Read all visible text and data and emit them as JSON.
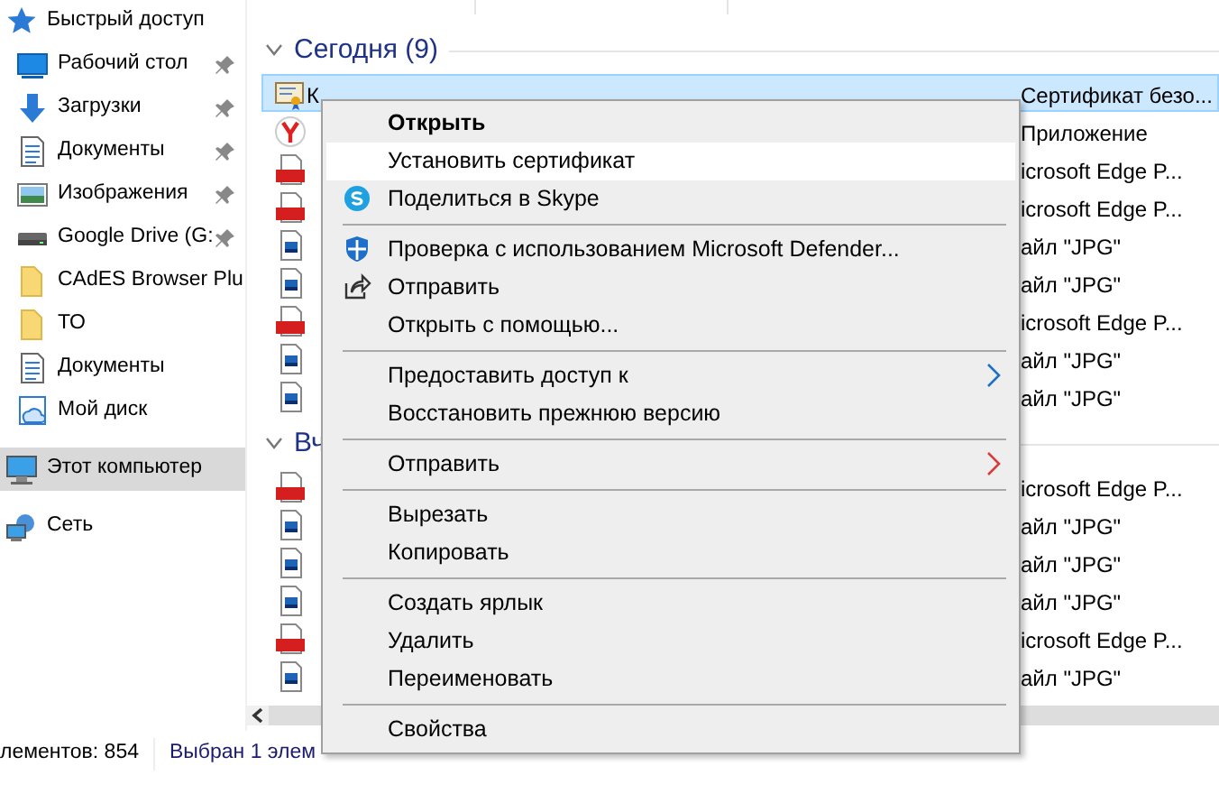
{
  "sidebar": {
    "items": [
      {
        "label": "Быстрый доступ",
        "kind": "star",
        "pinned": false,
        "selected": false
      },
      {
        "label": "Рабочий стол",
        "kind": "desktop",
        "pinned": true,
        "selected": false
      },
      {
        "label": "Загрузки",
        "kind": "download",
        "pinned": true,
        "selected": false
      },
      {
        "label": "Документы",
        "kind": "document",
        "pinned": true,
        "selected": false
      },
      {
        "label": "Изображения",
        "kind": "pictures",
        "pinned": true,
        "selected": false
      },
      {
        "label": "Google Drive (G:",
        "kind": "drive",
        "pinned": true,
        "selected": false
      },
      {
        "label": "CAdES Browser Plu",
        "kind": "folder",
        "pinned": false,
        "selected": false
      },
      {
        "label": "ТО",
        "kind": "folder",
        "pinned": false,
        "selected": false
      },
      {
        "label": "Документы",
        "kind": "document",
        "pinned": false,
        "selected": false
      },
      {
        "label": "Мой диск",
        "kind": "clouddrive",
        "pinned": false,
        "selected": false
      },
      {
        "label": "Этот компьютер",
        "kind": "computer",
        "pinned": false,
        "selected": true
      },
      {
        "label": "Сеть",
        "kind": "network",
        "pinned": false,
        "selected": false
      }
    ]
  },
  "file_list": {
    "groups": [
      {
        "title": "Сегодня (9)",
        "expanded": true,
        "rows": [
          {
            "kind": "certificate",
            "name": "К",
            "type": "Сертификат безо...",
            "selected": true
          },
          {
            "kind": "app",
            "type": "Приложение",
            "selected": false
          },
          {
            "kind": "pdf",
            "type": "icrosoft Edge P...",
            "selected": false
          },
          {
            "kind": "pdf",
            "type": "icrosoft Edge P...",
            "selected": false
          },
          {
            "kind": "image",
            "type": "айл \"JPG\"",
            "selected": false
          },
          {
            "kind": "image",
            "type": "айл \"JPG\"",
            "selected": false
          },
          {
            "kind": "pdf",
            "type": "icrosoft Edge P...",
            "selected": false
          },
          {
            "kind": "image",
            "type": "айл \"JPG\"",
            "selected": false
          },
          {
            "kind": "image",
            "type": "айл \"JPG\"",
            "selected": false
          }
        ]
      },
      {
        "title": "Вч",
        "expanded": true,
        "rows": [
          {
            "kind": "pdf",
            "type": "icrosoft Edge P...",
            "selected": false
          },
          {
            "kind": "image",
            "type": "айл \"JPG\"",
            "selected": false
          },
          {
            "kind": "image",
            "type": "айл \"JPG\"",
            "selected": false
          },
          {
            "kind": "image",
            "type": "айл \"JPG\"",
            "selected": false
          },
          {
            "kind": "pdf",
            "type": "icrosoft Edge P...",
            "selected": false
          },
          {
            "kind": "image",
            "type": "айл \"JPG\"",
            "selected": false
          }
        ]
      }
    ]
  },
  "status_bar": {
    "item_count": "лементов: 854",
    "selection": "Выбран 1 элем"
  },
  "context_menu": {
    "items": [
      {
        "kind": "item",
        "label": "Открыть",
        "bold": true,
        "highlighted": false
      },
      {
        "kind": "item",
        "label": "Установить сертификат",
        "bold": false,
        "highlighted": true
      },
      {
        "kind": "skype",
        "label": "Поделиться в Skype",
        "bold": false,
        "highlighted": false
      },
      {
        "kind": "separator"
      },
      {
        "kind": "shield",
        "label": "Проверка с использованием Microsoft Defender...",
        "bold": false,
        "highlighted": false
      },
      {
        "kind": "share",
        "label": "Отправить",
        "bold": false,
        "highlighted": false
      },
      {
        "kind": "item",
        "label": "Открыть с помощью...",
        "bold": false,
        "highlighted": false
      },
      {
        "kind": "separator"
      },
      {
        "kind": "item",
        "label": "Предоставить доступ к",
        "submenu": true,
        "bold": false,
        "highlighted": false
      },
      {
        "kind": "item",
        "label": "Восстановить прежнюю версию",
        "bold": false,
        "highlighted": false
      },
      {
        "kind": "separator"
      },
      {
        "kind": "item",
        "label": "Отправить",
        "submenu": true,
        "bold": false,
        "highlighted": false
      },
      {
        "kind": "separator"
      },
      {
        "kind": "item",
        "label": "Вырезать",
        "bold": false,
        "highlighted": false
      },
      {
        "kind": "item",
        "label": "Копировать",
        "bold": false,
        "highlighted": false
      },
      {
        "kind": "separator"
      },
      {
        "kind": "item",
        "label": "Создать ярлык",
        "bold": false,
        "highlighted": false
      },
      {
        "kind": "item",
        "label": "Удалить",
        "bold": false,
        "highlighted": false
      },
      {
        "kind": "item",
        "label": "Переименовать",
        "bold": false,
        "highlighted": false
      },
      {
        "kind": "separator"
      },
      {
        "kind": "item",
        "label": "Свойства",
        "bold": false,
        "highlighted": false
      }
    ]
  }
}
